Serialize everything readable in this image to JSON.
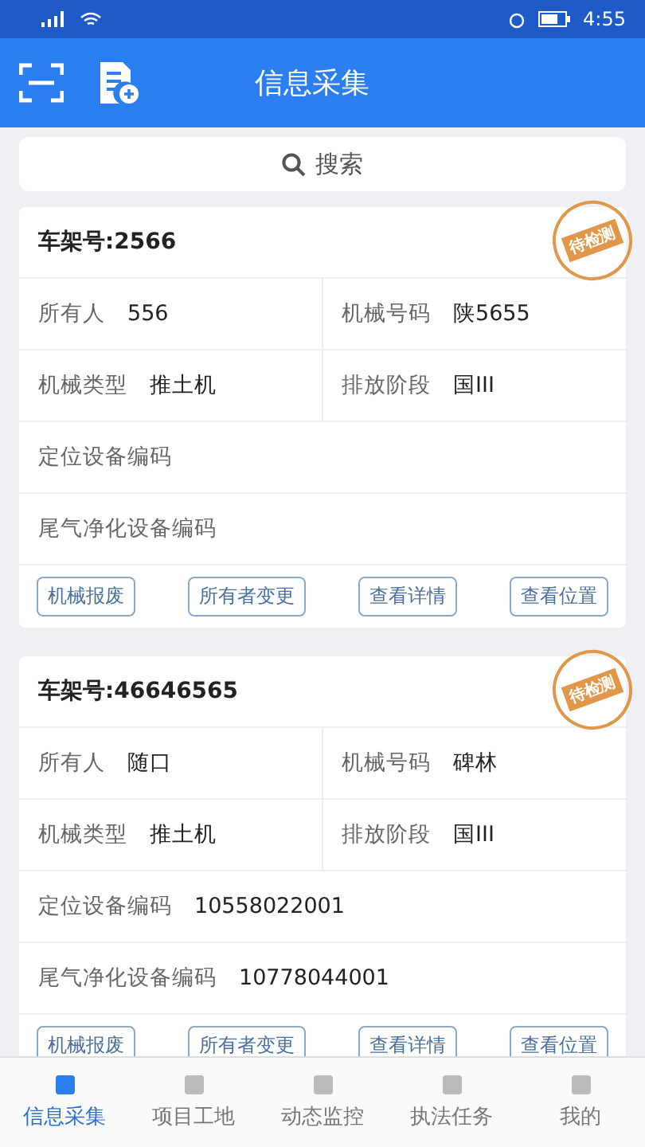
{
  "status_bar": {
    "time": "4:55"
  },
  "header": {
    "title": "信息采集"
  },
  "search": {
    "placeholder": "搜索"
  },
  "cards": [
    {
      "title": "车架号:2566",
      "stamp": "待检测",
      "fields": [
        {
          "label": "所有人",
          "value": "556",
          "kind": "half"
        },
        {
          "label": "机械号码",
          "value": "陕5655",
          "kind": "half"
        },
        {
          "label": "机械类型",
          "value": "推土机",
          "kind": "half"
        },
        {
          "label": "排放阶段",
          "value": "国III",
          "kind": "half"
        },
        {
          "label": "定位设备编码",
          "kind": "full"
        },
        {
          "label": "尾气净化设备编码",
          "kind": "full"
        }
      ],
      "buttons": [
        "机械报废",
        "所有者变更",
        "查看详情",
        "查看位置"
      ]
    },
    {
      "title": "车架号:46646565",
      "stamp": "待检测",
      "fields": [
        {
          "label": "所有人",
          "value": "随口",
          "kind": "half"
        },
        {
          "label": "机械号码",
          "value": "碑林",
          "kind": "half"
        },
        {
          "label": "机械类型",
          "value": "推土机",
          "kind": "half"
        },
        {
          "label": "排放阶段",
          "value": "国III",
          "kind": "half"
        },
        {
          "label": "定位设备编码",
          "value": "10558022001",
          "kind": "full"
        },
        {
          "label": "尾气净化设备编码",
          "value": "10778044001",
          "kind": "full"
        }
      ],
      "buttons": [
        "机械报废",
        "所有者变更",
        "查看详情",
        "查看位置"
      ]
    }
  ],
  "tab_bar": [
    {
      "label": "信息采集",
      "selected": true
    },
    {
      "label": "项目工地",
      "selected": false
    },
    {
      "label": "动态监控",
      "selected": false
    },
    {
      "label": "执法任务",
      "selected": false
    },
    {
      "label": "我的",
      "selected": false
    }
  ]
}
